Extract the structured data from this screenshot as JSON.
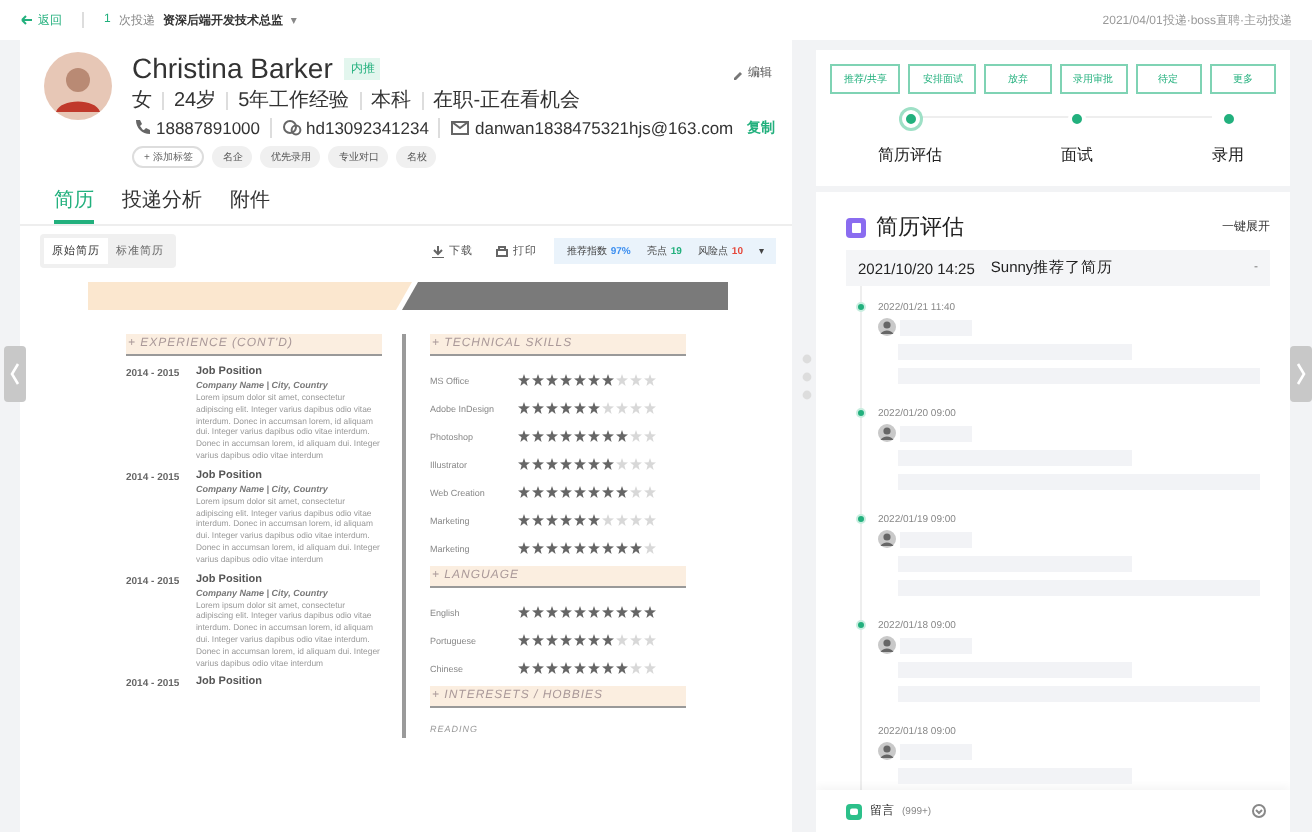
{
  "top_bar": {
    "back": "返回",
    "delivery_count": "1",
    "delivery_label": "次投递",
    "position": "资深后端开发技术总监",
    "position_caret": "▾",
    "source": "2021/04/01投递·boss直聘·主动投递"
  },
  "candidate": {
    "name": "Christina Barker",
    "badge": "内推",
    "edit": "编辑",
    "facts": [
      "女",
      "24岁",
      "5年工作经验",
      "本科",
      "在职-正在看机会"
    ],
    "contacts": [
      {
        "kind": "phone",
        "value": "18887891000"
      },
      {
        "kind": "wechat",
        "value": "hd13092341234"
      },
      {
        "kind": "email",
        "value": "danwan1838475321hjs@163.com"
      }
    ],
    "copy": "复制",
    "add_tag": "+ 添加标签",
    "tags": [
      "名企",
      "优先录用",
      "专业对口",
      "名校"
    ]
  },
  "tabs": [
    {
      "label": "简历",
      "selected": true
    },
    {
      "label": "投递分析",
      "selected": false
    },
    {
      "label": "附件",
      "selected": false
    }
  ],
  "resume_toolbar": {
    "views": [
      {
        "label": "原始简历",
        "selected": true
      },
      {
        "label": "标准简历",
        "selected": false
      }
    ],
    "actions": [
      {
        "kind": "download",
        "label": "下载"
      },
      {
        "kind": "print",
        "label": "打印"
      }
    ],
    "scores": [
      {
        "label": "推荐指数",
        "value": "97%",
        "color": "#3d8ff0"
      },
      {
        "label": "亮点",
        "value": "19",
        "color": "#22b07d"
      },
      {
        "label": "风险点",
        "value": "10",
        "color": "#e5483b"
      }
    ],
    "caret": "▾"
  },
  "resume": {
    "experience": {
      "title": "+ EXPERIENCE (CONT'D)",
      "entries": [
        {
          "dates": "2014 - 2015",
          "title": "Job Position",
          "company": "Company Name | City, Country",
          "description": "Lorem ipsum dolor sit amet, consectetur adipiscing elit. Integer varius dapibus odio vitae interdum. Donec in accumsan lorem, id aliquam dui. Integer varius dapibus odio vitae interdum. Donec in accumsan lorem, id aliquam dui. Integer varius dapibus odio vitae interdum"
        },
        {
          "dates": "2014 - 2015",
          "title": "Job Position",
          "company": "Company Name | City, Country",
          "description": "Lorem ipsum dolor sit amet, consectetur adipiscing elit. Integer varius dapibus odio vitae interdum. Donec in accumsan lorem, id aliquam dui. Integer varius dapibus odio vitae interdum. Donec in accumsan lorem, id aliquam dui. Integer varius dapibus odio vitae interdum"
        },
        {
          "dates": "2014 - 2015",
          "title": "Job Position",
          "company": "Company Name | City, Country",
          "description": "Lorem ipsum dolor sit amet, consectetur adipiscing elit. Integer varius dapibus odio vitae interdum. Donec in accumsan lorem, id aliquam dui. Integer varius dapibus odio vitae interdum. Donec in accumsan lorem, id aliquam dui. Integer varius dapibus odio vitae interdum"
        },
        {
          "dates": "2014 - 2015",
          "title": "Job Position"
        }
      ]
    },
    "sections": [
      {
        "kind": "ratings",
        "title": "+ TECHNICAL SKILLS",
        "items": [
          {
            "name": "MS Office",
            "stars": 7
          },
          {
            "name": "Adobe InDesign",
            "stars": 6
          },
          {
            "name": "Photoshop",
            "stars": 8
          },
          {
            "name": "Illustrator",
            "stars": 7
          },
          {
            "name": "Web Creation",
            "stars": 8
          },
          {
            "name": "Marketing",
            "stars": 6
          },
          {
            "name": "Marketing",
            "stars": 9
          }
        ]
      },
      {
        "kind": "ratings",
        "title": "+ LANGUAGE",
        "items": [
          {
            "name": "English",
            "stars": 10
          },
          {
            "name": "Portuguese",
            "stars": 7
          },
          {
            "name": "Chinese",
            "stars": 8
          }
        ]
      },
      {
        "kind": "list",
        "title": "+ INTERESETS / HOBBIES",
        "items": [
          {
            "name": "READING"
          }
        ]
      }
    ]
  },
  "pipeline": {
    "actions": [
      "推荐/共享",
      "安排面试",
      "放弃",
      "录用审批",
      "待定",
      "更多"
    ],
    "steps": [
      {
        "label": "简历评估",
        "selected": true
      },
      {
        "label": "面试",
        "selected": false
      },
      {
        "label": "录用",
        "selected": false
      }
    ]
  },
  "evaluation": {
    "title": "简历评估",
    "expand_all": "一键展开",
    "summary": {
      "time": "2021/10/20 14:25",
      "text": "Sunny推荐了简历",
      "toggle": "-"
    },
    "timeline": [
      {
        "time": "2022/01/21 11:40",
        "dot": true
      },
      {
        "time": "2022/01/20 09:00",
        "dot": true
      },
      {
        "time": "2022/01/19 09:00",
        "dot": true
      },
      {
        "time": "2022/01/18 09:00",
        "dot": true
      },
      {
        "time": "2022/01/18 09:00",
        "dot": false
      }
    ]
  },
  "comment_bar": {
    "label": "留言",
    "count": "(999+)"
  }
}
